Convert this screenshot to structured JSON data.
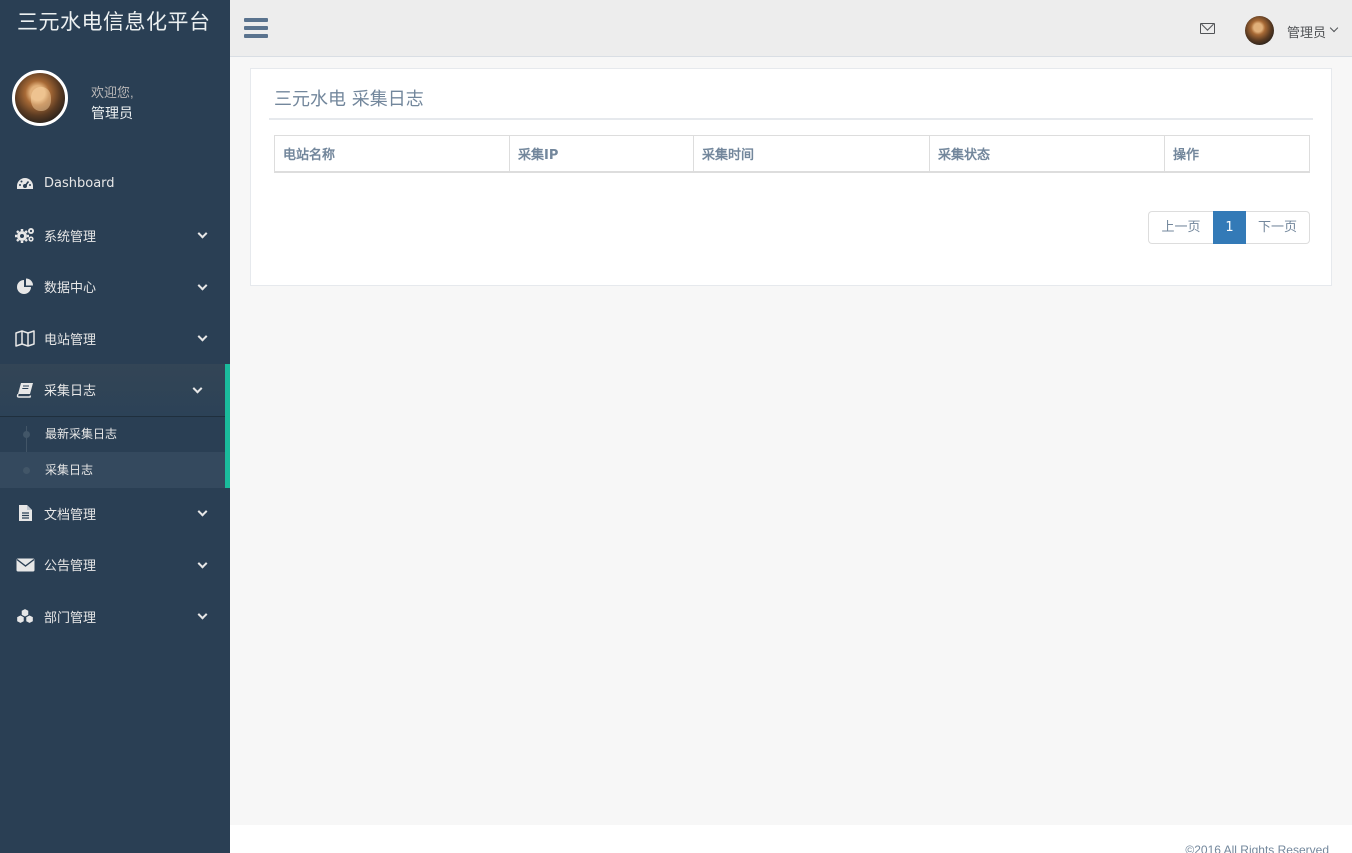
{
  "app": {
    "title": "三元水电信息化平台"
  },
  "profile": {
    "welcome": "欢迎您,",
    "name": "管理员"
  },
  "sidebar": {
    "items": [
      {
        "label": "Dashboard",
        "icon": "dashboard-icon"
      },
      {
        "label": "系统管理",
        "icon": "cogs-icon"
      },
      {
        "label": "数据中心",
        "icon": "pie-chart-icon"
      },
      {
        "label": "电站管理",
        "icon": "map-icon"
      },
      {
        "label": "采集日志",
        "icon": "book-icon",
        "active": true
      },
      {
        "label": "文档管理",
        "icon": "file-text-icon"
      },
      {
        "label": "公告管理",
        "icon": "envelope-icon"
      },
      {
        "label": "部门管理",
        "icon": "cubes-icon"
      }
    ],
    "submenu": [
      {
        "label": "最新采集日志"
      },
      {
        "label": "采集日志",
        "current": true
      }
    ]
  },
  "topnav": {
    "user": "管理员"
  },
  "panel": {
    "title": "三元水电 采集日志",
    "columns": [
      "电站名称",
      "采集IP",
      "采集时间",
      "采集状态",
      "操作"
    ]
  },
  "pagination": {
    "prev": "上一页",
    "current": "1",
    "next": "下一页"
  },
  "footer": {
    "text": "©2016 All Rights Reserved"
  },
  "colors": {
    "sidebar": "#2a3f54",
    "accent": "#1abb9c",
    "primary": "#337ab7",
    "text": "#73879c"
  }
}
